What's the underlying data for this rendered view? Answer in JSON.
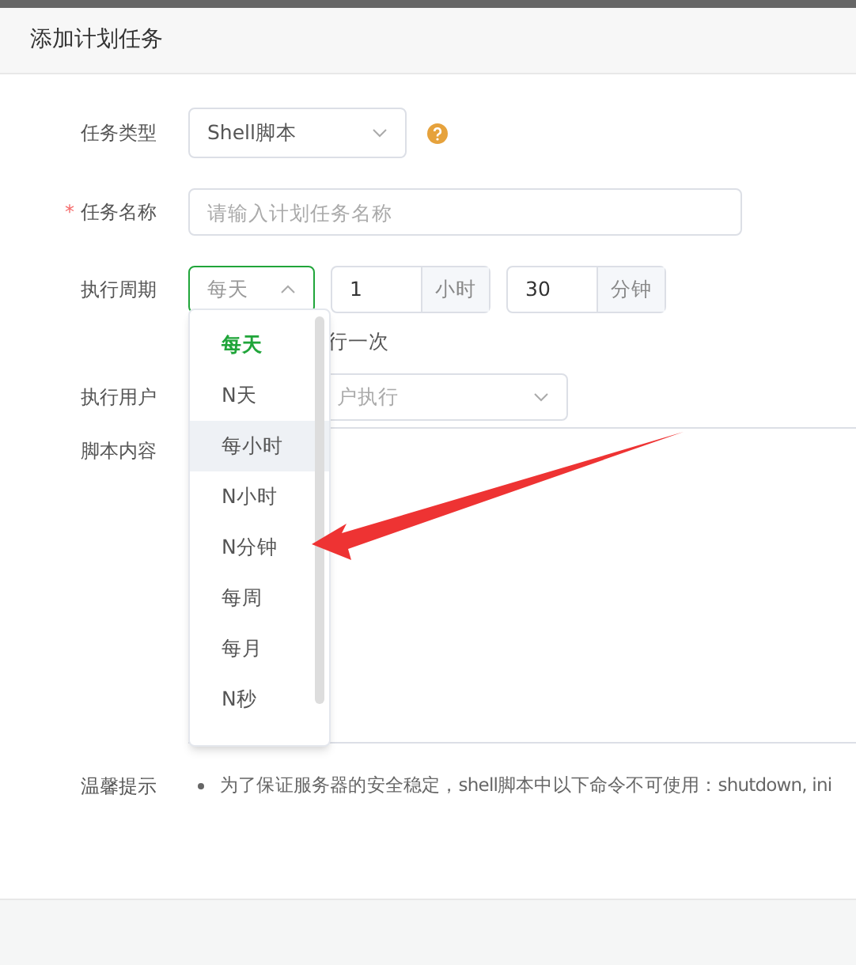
{
  "dialog": {
    "title": "添加计划任务"
  },
  "form": {
    "task_type": {
      "label": "任务类型",
      "value": "Shell脚本"
    },
    "task_name": {
      "label": "任务名称",
      "required": true,
      "required_mark": "*",
      "placeholder": "请输入计划任务名称"
    },
    "cycle": {
      "label": "执行周期",
      "value": "每天",
      "expanded": true,
      "hours": "1",
      "hours_unit": "小时",
      "minutes": "30",
      "minutes_unit": "分钟",
      "hint": "行一次"
    },
    "user": {
      "label": "执行用户",
      "placeholder": "户执行"
    },
    "script": {
      "label": "脚本内容"
    },
    "tips": {
      "label": "温馨提示",
      "items": [
        "为了保证服务器的安全稳定，shell脚本中以下命令不可使用：shutdown, ini"
      ]
    }
  },
  "dropdown": {
    "options": [
      {
        "label": "每天",
        "selected": true,
        "hovered": false
      },
      {
        "label": "N天",
        "selected": false,
        "hovered": false
      },
      {
        "label": "每小时",
        "selected": false,
        "hovered": true
      },
      {
        "label": "N小时",
        "selected": false,
        "hovered": false
      },
      {
        "label": "N分钟",
        "selected": false,
        "hovered": false
      },
      {
        "label": "每周",
        "selected": false,
        "hovered": false
      },
      {
        "label": "每月",
        "selected": false,
        "hovered": false
      },
      {
        "label": "N秒",
        "selected": false,
        "hovered": false
      }
    ]
  }
}
